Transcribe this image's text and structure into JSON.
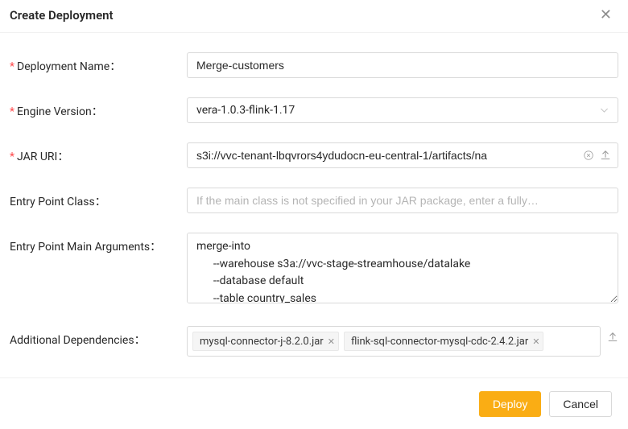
{
  "header": {
    "title": "Create Deployment"
  },
  "form": {
    "deployment_name": {
      "label": "Deployment Name",
      "value": "Merge-customers"
    },
    "engine_version": {
      "label": "Engine Version",
      "value": "vera-1.0.3-flink-1.17"
    },
    "jar_uri": {
      "label": "JAR URI",
      "value": "s3i://vvc-tenant-lbqvrors4ydudocn-eu-central-1/artifacts/na"
    },
    "entry_point_class": {
      "label": "Entry Point Class",
      "placeholder": "If the main class is not specified in your JAR package, enter a fully…"
    },
    "entry_point_args": {
      "label": "Entry Point Main Arguments",
      "value": "merge-into\n      --warehouse s3a://vvc-stage-streamhouse/datalake\n      --database default\n      --table country_sales"
    },
    "additional_dependencies": {
      "label": "Additional Dependencies",
      "tags": [
        "mysql-connector-j-8.2.0.jar",
        "flink-sql-connector-mysql-cdc-2.4.2.jar"
      ]
    }
  },
  "footer": {
    "deploy": "Deploy",
    "cancel": "Cancel"
  }
}
